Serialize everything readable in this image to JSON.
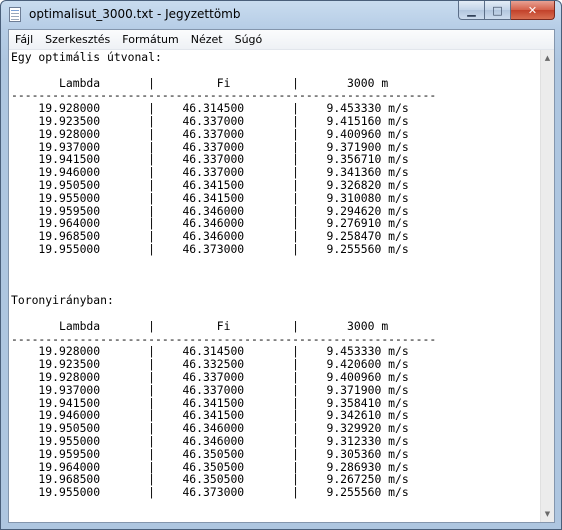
{
  "window": {
    "title": "optimalisut_3000.txt - Jegyzettömb",
    "icon": "notepad-icon"
  },
  "caption_buttons": {
    "minimize": "▁",
    "maximize": "□",
    "close": "✕"
  },
  "menu": {
    "file": "Fájl",
    "edit": "Szerkesztés",
    "format": "Formátum",
    "view": "Nézet",
    "help": "Súgó"
  },
  "scrollbar": {
    "up_glyph": "▲",
    "down_glyph": "▼"
  },
  "document": {
    "section1_title": "Egy optimális útvonal:",
    "section2_title": "Toronyirányban:",
    "column_headers": [
      "Lambda",
      "Fi",
      "3000 m"
    ],
    "separator": "--------------------------------------------------------------",
    "unit": "m/s",
    "section1_rows": [
      [
        "19.928000",
        "46.314500",
        "9.453330"
      ],
      [
        "19.923500",
        "46.337000",
        "9.415160"
      ],
      [
        "19.928000",
        "46.337000",
        "9.400960"
      ],
      [
        "19.937000",
        "46.337000",
        "9.371900"
      ],
      [
        "19.941500",
        "46.337000",
        "9.356710"
      ],
      [
        "19.946000",
        "46.337000",
        "9.341360"
      ],
      [
        "19.950500",
        "46.341500",
        "9.326820"
      ],
      [
        "19.955000",
        "46.341500",
        "9.310080"
      ],
      [
        "19.959500",
        "46.346000",
        "9.294620"
      ],
      [
        "19.964000",
        "46.346000",
        "9.276910"
      ],
      [
        "19.968500",
        "46.346000",
        "9.258470"
      ],
      [
        "19.955000",
        "46.373000",
        "9.255560"
      ]
    ],
    "section2_rows": [
      [
        "19.928000",
        "46.314500",
        "9.453330"
      ],
      [
        "19.923500",
        "46.332500",
        "9.420600"
      ],
      [
        "19.928000",
        "46.337000",
        "9.400960"
      ],
      [
        "19.937000",
        "46.337000",
        "9.371900"
      ],
      [
        "19.941500",
        "46.341500",
        "9.358410"
      ],
      [
        "19.946000",
        "46.341500",
        "9.342610"
      ],
      [
        "19.950500",
        "46.346000",
        "9.329920"
      ],
      [
        "19.955000",
        "46.346000",
        "9.312330"
      ],
      [
        "19.959500",
        "46.350500",
        "9.305360"
      ],
      [
        "19.964000",
        "46.350500",
        "9.286930"
      ],
      [
        "19.968500",
        "46.350500",
        "9.267250"
      ],
      [
        "19.955000",
        "46.373000",
        "9.255560"
      ]
    ]
  }
}
